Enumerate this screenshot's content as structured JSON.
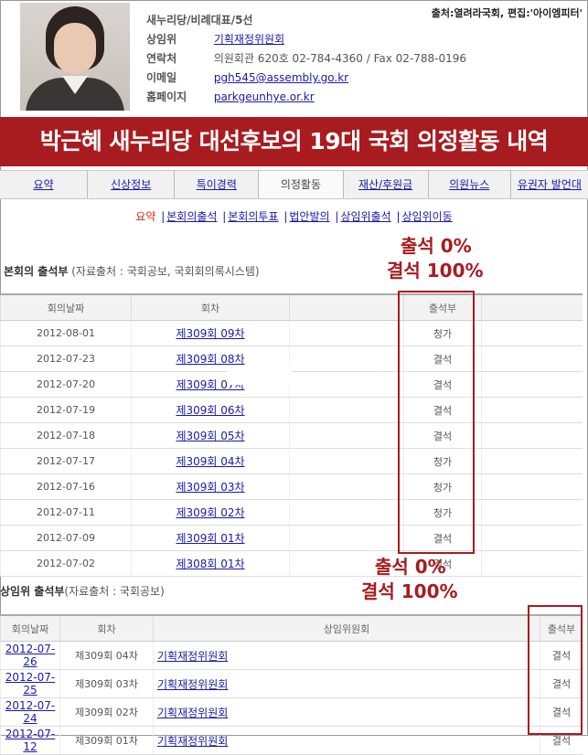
{
  "source_note": "출처:열려라국회, 편집:'아이엠피터'",
  "profile": {
    "party": "새누리당/비례대표/5선",
    "rows": [
      {
        "label": "상임위",
        "value": "기획재정위원회",
        "link": true
      },
      {
        "label": "연락처",
        "value": "의원회관 620호 02-784-4360 / Fax 02-788-0196",
        "link": false
      },
      {
        "label": "이메일",
        "value": "pgh545@assembly.go.kr",
        "link": true
      },
      {
        "label": "홈페이지",
        "value": "parkgeunhye.or.kr",
        "link": true
      }
    ]
  },
  "banner": "박근혜 새누리당 대선후보의 19대 국회 의정활동 내역",
  "tabs": [
    "요약",
    "신상정보",
    "특이경력",
    "의정활동",
    "재산/후원금",
    "의원뉴스",
    "유권자 발언대"
  ],
  "active_tab": 3,
  "sublinks": [
    "요약",
    "본회의출석",
    "본회의투표",
    "법안발의",
    "상임위출석",
    "상임위이동"
  ],
  "annotation_1": {
    "line1": "출석 0%",
    "line2": "결석 100%"
  },
  "annotation_2": {
    "line1": "출석 0%",
    "line2": "결석 100%"
  },
  "plenary": {
    "title": "본회의 출석부",
    "note": "(자료출처 : 국회공보, 국회회의록시스템)",
    "headers": [
      "회의날짜",
      "회차",
      "",
      "출석부",
      ""
    ],
    "rows": [
      {
        "date": "2012-08-01",
        "session": "제309회 09차",
        "status": "청가"
      },
      {
        "date": "2012-07-23",
        "session": "제309회 08차",
        "status": "결석"
      },
      {
        "date": "2012-07-20",
        "session": "제309회 07차",
        "status": "결석"
      },
      {
        "date": "2012-07-19",
        "session": "제309회 06차",
        "status": "결석"
      },
      {
        "date": "2012-07-18",
        "session": "제309회 05차",
        "status": "결석"
      },
      {
        "date": "2012-07-17",
        "session": "제309회 04차",
        "status": "청가"
      },
      {
        "date": "2012-07-16",
        "session": "제309회 03차",
        "status": "청가"
      },
      {
        "date": "2012-07-11",
        "session": "제309회 02차",
        "status": "청가"
      },
      {
        "date": "2012-07-09",
        "session": "제309회 01차",
        "status": "결석"
      },
      {
        "date": "2012-07-02",
        "session": "제308회 01차",
        "status": "결석"
      }
    ]
  },
  "committee": {
    "title": "상임위 출석부",
    "note": "(자료출처 : 국회공보)",
    "headers": [
      "회의날짜",
      "회차",
      "상임위원회",
      "출석부"
    ],
    "rows": [
      {
        "date": "2012-07-26",
        "session": "제309회 04차",
        "committee": "기획재정위원회",
        "status": "결석"
      },
      {
        "date": "2012-07-25",
        "session": "제309회 03차",
        "committee": "기획재정위원회",
        "status": "결석"
      },
      {
        "date": "2012-07-24",
        "session": "제309회 02차",
        "committee": "기획재정위원회",
        "status": "결석"
      },
      {
        "date": "2012-07-12",
        "session": "제309회 01차",
        "committee": "기획재정위원회",
        "status": "결석"
      }
    ]
  },
  "colors": {
    "accent": "#a81b1f",
    "link": "#1a1aa8",
    "current_sublink": "#d32a17"
  }
}
